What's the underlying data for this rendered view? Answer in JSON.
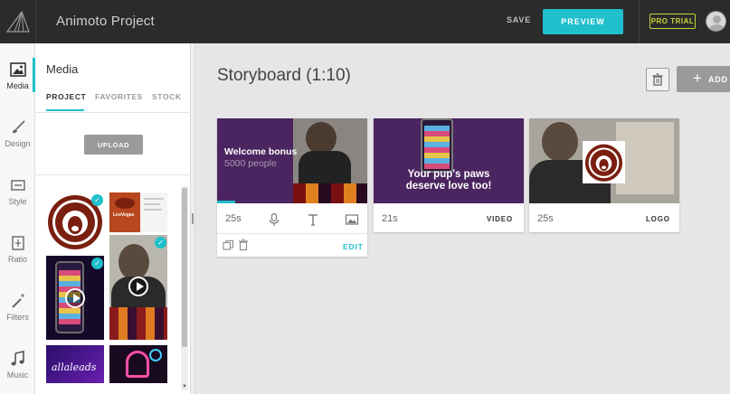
{
  "app": {
    "title": "Animoto Project"
  },
  "topbar": {
    "save_label": "SAVE",
    "preview_label": "PREVIEW",
    "pro_trial_label": "PRO TRIAL"
  },
  "colors": {
    "accent": "#1fbfcc",
    "pro": "#c6d53a",
    "topbar": "#2b2b2b",
    "card_purple": "#4b2560"
  },
  "rail": {
    "items": [
      {
        "label": "Media",
        "icon": "image-icon"
      },
      {
        "label": "Design",
        "icon": "brush-icon"
      },
      {
        "label": "Style",
        "icon": "style-icon"
      },
      {
        "label": "Ratio",
        "icon": "ratio-icon"
      },
      {
        "label": "Filters",
        "icon": "magic-wand-icon"
      },
      {
        "label": "Music",
        "icon": "music-note-icon"
      }
    ]
  },
  "media_panel": {
    "title": "Media",
    "tabs": [
      {
        "label": "PROJECT",
        "active": true
      },
      {
        "label": "FAVORITES",
        "active": false
      },
      {
        "label": "STOCK",
        "active": false
      }
    ],
    "upload_label": "UPLOAD",
    "thumb_text": {
      "leovegas": "LeoVegas",
      "allaleads": "allaleads"
    }
  },
  "storyboard": {
    "title": "Storyboard (1:10)",
    "add_label": "ADD",
    "cards": [
      {
        "duration": "25s",
        "overlay_title": "Welcome bonus",
        "overlay_sub": "5000 people",
        "edit_label": "EDIT"
      },
      {
        "duration": "21s",
        "overlay_text_1": "Your pup's paws",
        "overlay_text_2": "deserve love too!",
        "tag": "VIDEO"
      },
      {
        "duration": "25s",
        "tag": "LOGO"
      }
    ]
  }
}
